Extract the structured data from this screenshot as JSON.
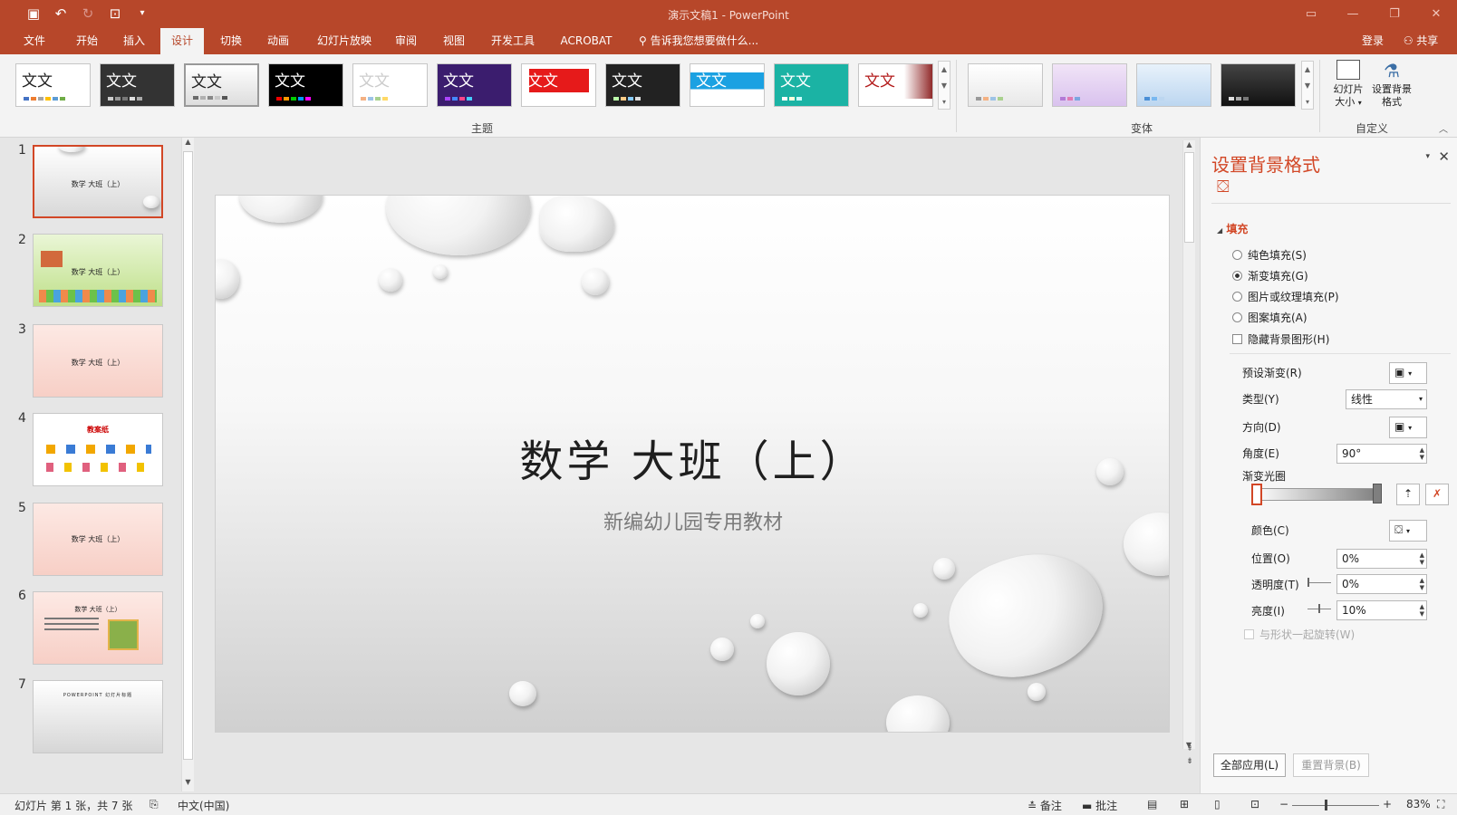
{
  "window": {
    "title": "演示文稿1 - PowerPoint"
  },
  "qat": {
    "save": "save-icon",
    "undo": "undo-icon",
    "redo": "redo-icon",
    "present": "present-icon",
    "more": "more-icon"
  },
  "tabs": [
    "文件",
    "开始",
    "插入",
    "设计",
    "切换",
    "动画",
    "幻灯片放映",
    "审阅",
    "视图",
    "开发工具",
    "ACROBAT"
  ],
  "active_tab": "设计",
  "tell_me": "告诉我您想要做什么...",
  "account": {
    "login": "登录",
    "share": "共享"
  },
  "themes": {
    "sample_text": "文文",
    "group_label": "主题"
  },
  "variants": {
    "group_label": "变体"
  },
  "customize": {
    "slide_size": "幻灯片大小",
    "slide_size_arrow": "▾",
    "format_bg": "设置背景格式",
    "group_label": "自定义"
  },
  "slides": [
    "1",
    "2",
    "3",
    "4",
    "5",
    "6",
    "7"
  ],
  "slide_mini": {
    "title": "数学 大班（上）",
    "s4_title": "教案纸",
    "s7_text": "POWERPOINT 幻灯片标题"
  },
  "main_slide": {
    "title": "数学  大班（上）",
    "subtitle": "新编幼儿园专用教材"
  },
  "format_pane": {
    "title": "设置背景格式",
    "section": "填充",
    "options": [
      "纯色填充(S)",
      "渐变填充(G)",
      "图片或纹理填充(P)",
      "图案填充(A)"
    ],
    "selected_option": "渐变填充(G)",
    "hide_bg": "隐藏背景图形(H)",
    "preset": "预设渐变(R)",
    "type_label": "类型(Y)",
    "type_value": "线性",
    "direction": "方向(D)",
    "angle_label": "角度(E)",
    "angle_value": "90°",
    "stops_label": "渐变光圈",
    "color_label": "颜色(C)",
    "position_label": "位置(O)",
    "position_value": "0%",
    "transparency_label": "透明度(T)",
    "transparency_value": "0%",
    "brightness_label": "亮度(I)",
    "brightness_value": "10%",
    "rotate_with_shape": "与形状一起旋转(W)",
    "apply_all": "全部应用(L)",
    "reset": "重置背景(B)"
  },
  "status": {
    "slide_info": "幻灯片 第 1 张，共 7 张",
    "language": "中文(中国)",
    "notes": "备注",
    "comments": "批注",
    "zoom": "83%"
  },
  "colors": {
    "accent": "#b7472a",
    "selected": "#d24726"
  }
}
